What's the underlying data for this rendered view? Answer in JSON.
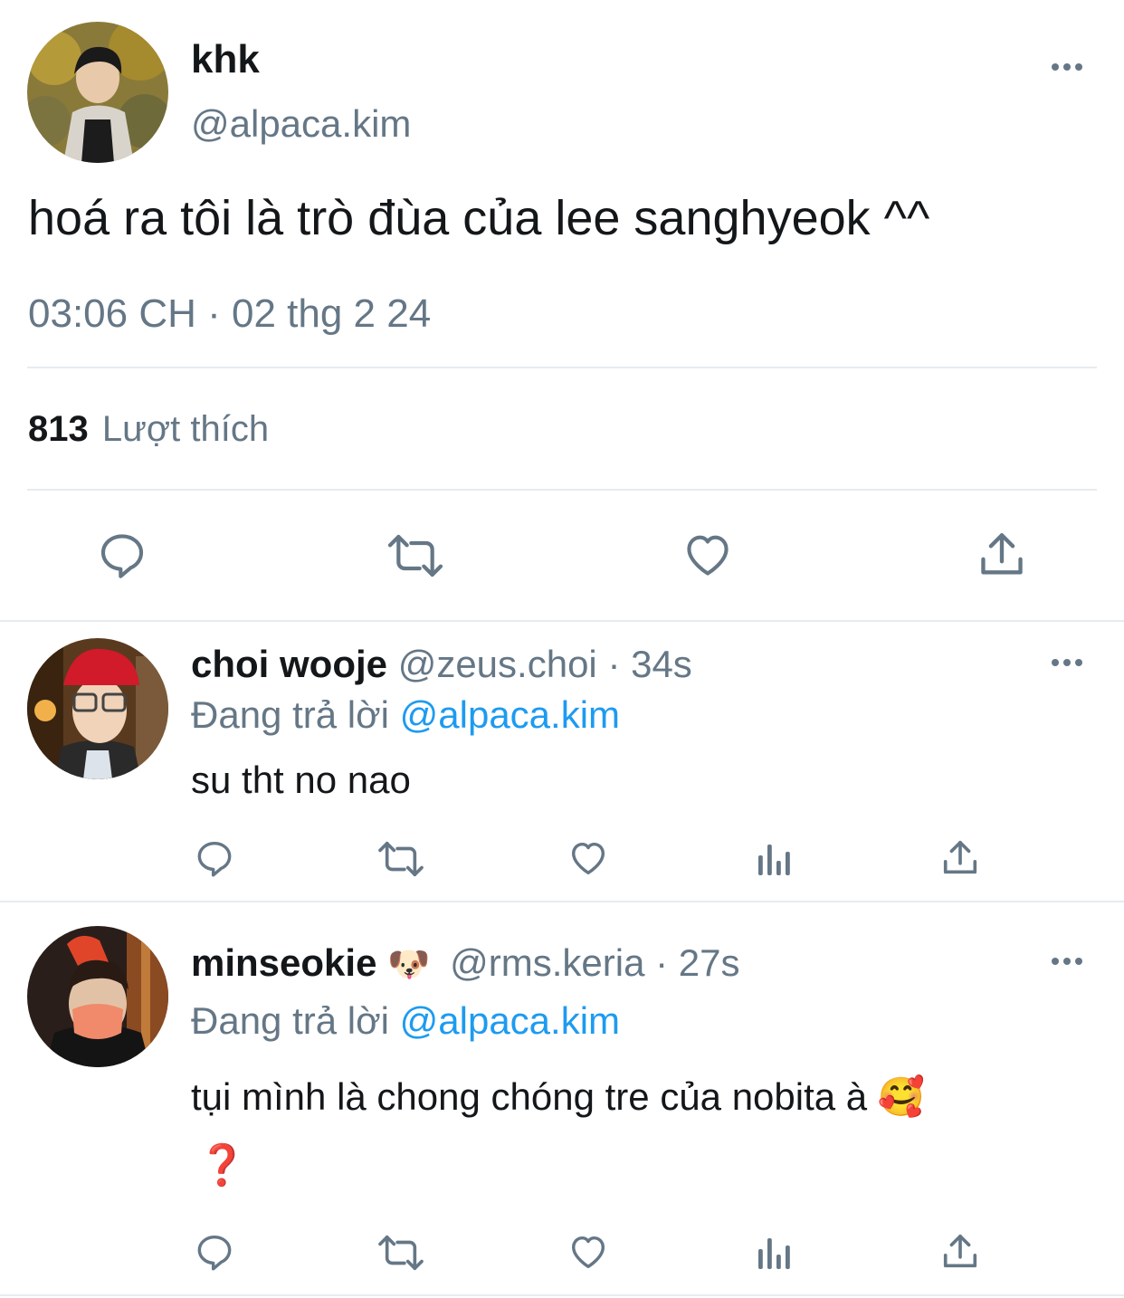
{
  "main_tweet": {
    "display_name": "khk",
    "handle": "@alpaca.kim",
    "text": "hoá ra tôi là trò đùa của lee sanghyeok ^^",
    "timestamp": "03:06 CH · 02 thg 2 24",
    "likes_count": "813",
    "likes_label": "Lượt thích",
    "actions": [
      "reply-icon",
      "retweet-icon",
      "like-icon",
      "share-icon"
    ]
  },
  "replies": [
    {
      "display_name": "choi wooje",
      "handle": "@zeus.choi",
      "time": "· 34s",
      "replying_prefix": "Đang trả lời",
      "replying_to": "@alpaca.kim",
      "text": "su tht no nao"
    },
    {
      "display_name": "minseokie",
      "name_emoji": "🐶",
      "handle": "@rms.keria",
      "time": "· 27s",
      "replying_prefix": "Đang trả lời",
      "replying_to": "@alpaca.kim",
      "text": "tụi mình là chong chóng tre của nobita à",
      "text_emoji": "🥰",
      "text_line2": "❓"
    }
  ],
  "colors": {
    "text": "#14171a",
    "muted": "#657786",
    "link": "#1d9bf0",
    "divider": "#e6ecf0",
    "question_mark": "#d0021b"
  }
}
